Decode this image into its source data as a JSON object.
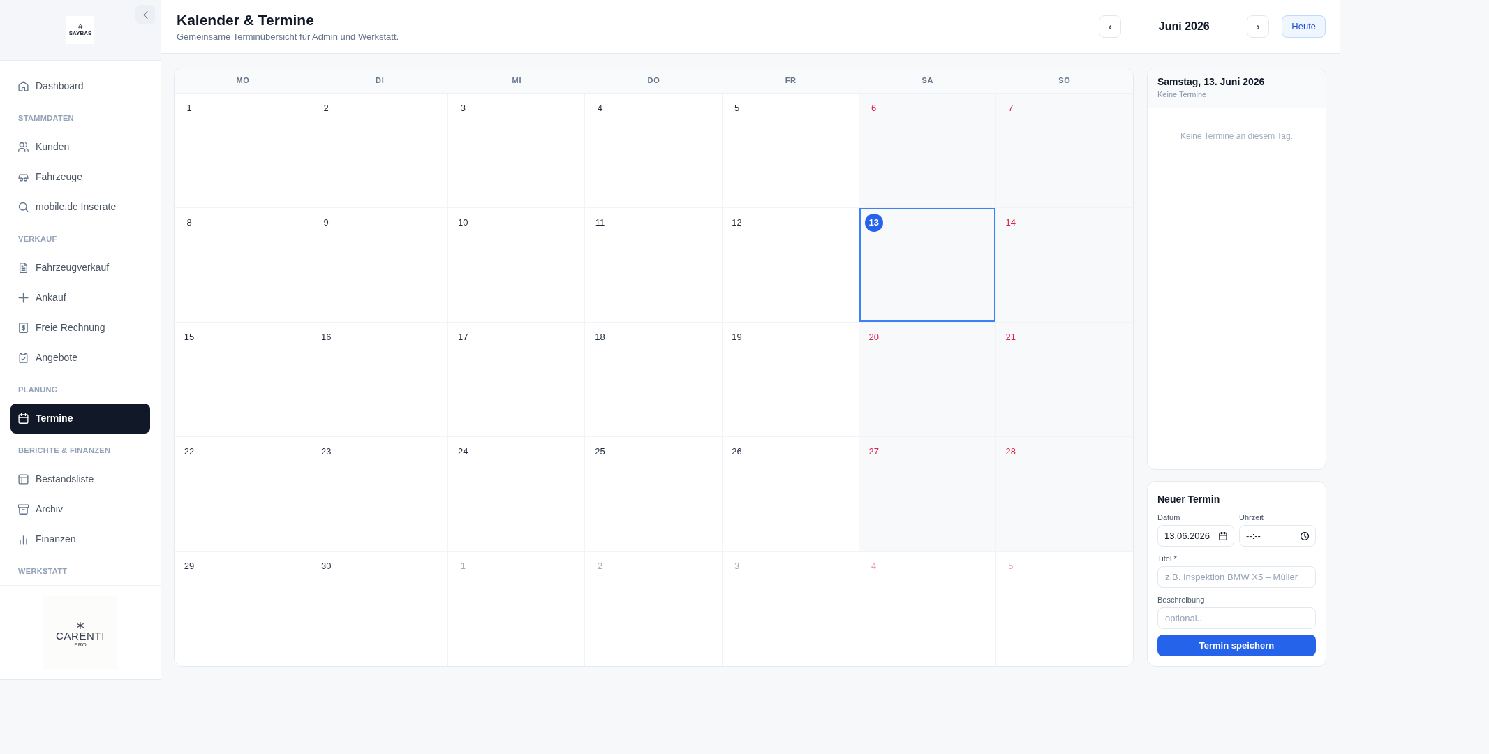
{
  "sidebar": {
    "logo_text": "SAYBAS",
    "groups": [
      {
        "items": [
          {
            "label": "Dashboard",
            "selected": false
          }
        ]
      },
      {
        "heading": "STAMMDATEN",
        "items": [
          {
            "label": "Kunden",
            "selected": false
          },
          {
            "label": "Fahrzeuge",
            "selected": false
          },
          {
            "label": "mobile.de Inserate",
            "selected": false
          }
        ]
      },
      {
        "heading": "VERKAUF",
        "items": [
          {
            "label": "Fahrzeugverkauf",
            "selected": false
          },
          {
            "label": "Ankauf",
            "selected": false
          },
          {
            "label": "Freie Rechnung",
            "selected": false
          },
          {
            "label": "Angebote",
            "selected": false
          }
        ]
      },
      {
        "heading": "PLANUNG",
        "items": [
          {
            "label": "Termine",
            "selected": true
          }
        ]
      },
      {
        "heading": "BERICHTE & FINANZEN",
        "items": [
          {
            "label": "Bestandsliste",
            "selected": false
          },
          {
            "label": "Archiv",
            "selected": false
          },
          {
            "label": "Finanzen",
            "selected": false
          }
        ]
      },
      {
        "heading": "WERKSTATT"
      }
    ],
    "brand": {
      "name": "CARENTI",
      "tagline": "PRO"
    }
  },
  "header": {
    "title": "Kalender & Termine",
    "subtitle": "Gemeinsame Terminübersicht für Admin und Werkstatt.",
    "prev_button": "‹",
    "month": "Juni 2026",
    "next_button": "›",
    "today_button": "Heute"
  },
  "calendar": {
    "weekdays": [
      "MO",
      "DI",
      "MI",
      "DO",
      "FR",
      "SA",
      "SO"
    ],
    "weeks": [
      {
        "days": [
          {
            "day": "1",
            "in_month": true,
            "weekend": false,
            "selected": false
          },
          {
            "day": "2",
            "in_month": true,
            "weekend": false,
            "selected": false
          },
          {
            "day": "3",
            "in_month": true,
            "weekend": false,
            "selected": false
          },
          {
            "day": "4",
            "in_month": true,
            "weekend": false,
            "selected": false
          },
          {
            "day": "5",
            "in_month": true,
            "weekend": false,
            "selected": false
          },
          {
            "day": "6",
            "in_month": true,
            "weekend": true,
            "selected": false
          },
          {
            "day": "7",
            "in_month": true,
            "weekend": true,
            "selected": false
          }
        ]
      },
      {
        "days": [
          {
            "day": "8",
            "in_month": true,
            "weekend": false,
            "selected": false
          },
          {
            "day": "9",
            "in_month": true,
            "weekend": false,
            "selected": false
          },
          {
            "day": "10",
            "in_month": true,
            "weekend": false,
            "selected": false
          },
          {
            "day": "11",
            "in_month": true,
            "weekend": false,
            "selected": false
          },
          {
            "day": "12",
            "in_month": true,
            "weekend": false,
            "selected": false
          },
          {
            "day": "13",
            "in_month": true,
            "weekend": true,
            "selected": true
          },
          {
            "day": "14",
            "in_month": true,
            "weekend": true,
            "selected": false
          }
        ]
      },
      {
        "days": [
          {
            "day": "15",
            "in_month": true,
            "weekend": false,
            "selected": false
          },
          {
            "day": "16",
            "in_month": true,
            "weekend": false,
            "selected": false
          },
          {
            "day": "17",
            "in_month": true,
            "weekend": false,
            "selected": false
          },
          {
            "day": "18",
            "in_month": true,
            "weekend": false,
            "selected": false
          },
          {
            "day": "19",
            "in_month": true,
            "weekend": false,
            "selected": false
          },
          {
            "day": "20",
            "in_month": true,
            "weekend": true,
            "selected": false
          },
          {
            "day": "21",
            "in_month": true,
            "weekend": true,
            "selected": false
          }
        ]
      },
      {
        "days": [
          {
            "day": "22",
            "in_month": true,
            "weekend": false,
            "selected": false
          },
          {
            "day": "23",
            "in_month": true,
            "weekend": false,
            "selected": false
          },
          {
            "day": "24",
            "in_month": true,
            "weekend": false,
            "selected": false
          },
          {
            "day": "25",
            "in_month": true,
            "weekend": false,
            "selected": false
          },
          {
            "day": "26",
            "in_month": true,
            "weekend": false,
            "selected": false
          },
          {
            "day": "27",
            "in_month": true,
            "weekend": true,
            "selected": false
          },
          {
            "day": "28",
            "in_month": true,
            "weekend": true,
            "selected": false
          }
        ]
      },
      {
        "days": [
          {
            "day": "29",
            "in_month": true,
            "weekend": false,
            "selected": false
          },
          {
            "day": "30",
            "in_month": true,
            "weekend": false,
            "selected": false
          },
          {
            "day": "1",
            "in_month": false,
            "weekend": false,
            "selected": false
          },
          {
            "day": "2",
            "in_month": false,
            "weekend": false,
            "selected": false
          },
          {
            "day": "3",
            "in_month": false,
            "weekend": false,
            "selected": false
          },
          {
            "day": "4",
            "in_month": false,
            "weekend": true,
            "selected": false
          },
          {
            "day": "5",
            "in_month": false,
            "weekend": true,
            "selected": false
          }
        ]
      }
    ]
  },
  "day_panel": {
    "title": "Samstag, 13. Juni 2026",
    "summary": "Keine Termine",
    "empty_message": "Keine Termine an diesem Tag."
  },
  "new_appointment": {
    "title": "Neuer Termin",
    "fields": [
      {
        "kind": "date",
        "label": "Datum",
        "value": "13.06.2026"
      },
      {
        "kind": "time",
        "label": "Uhrzeit",
        "value": "--:--"
      },
      {
        "kind": "text",
        "label": "Titel *",
        "placeholder": "z.B. Inspektion BMW X5 – Müller"
      },
      {
        "kind": "text",
        "label": "Beschreibung",
        "placeholder": "optional..."
      }
    ],
    "submit_button": "Termin speichern"
  }
}
